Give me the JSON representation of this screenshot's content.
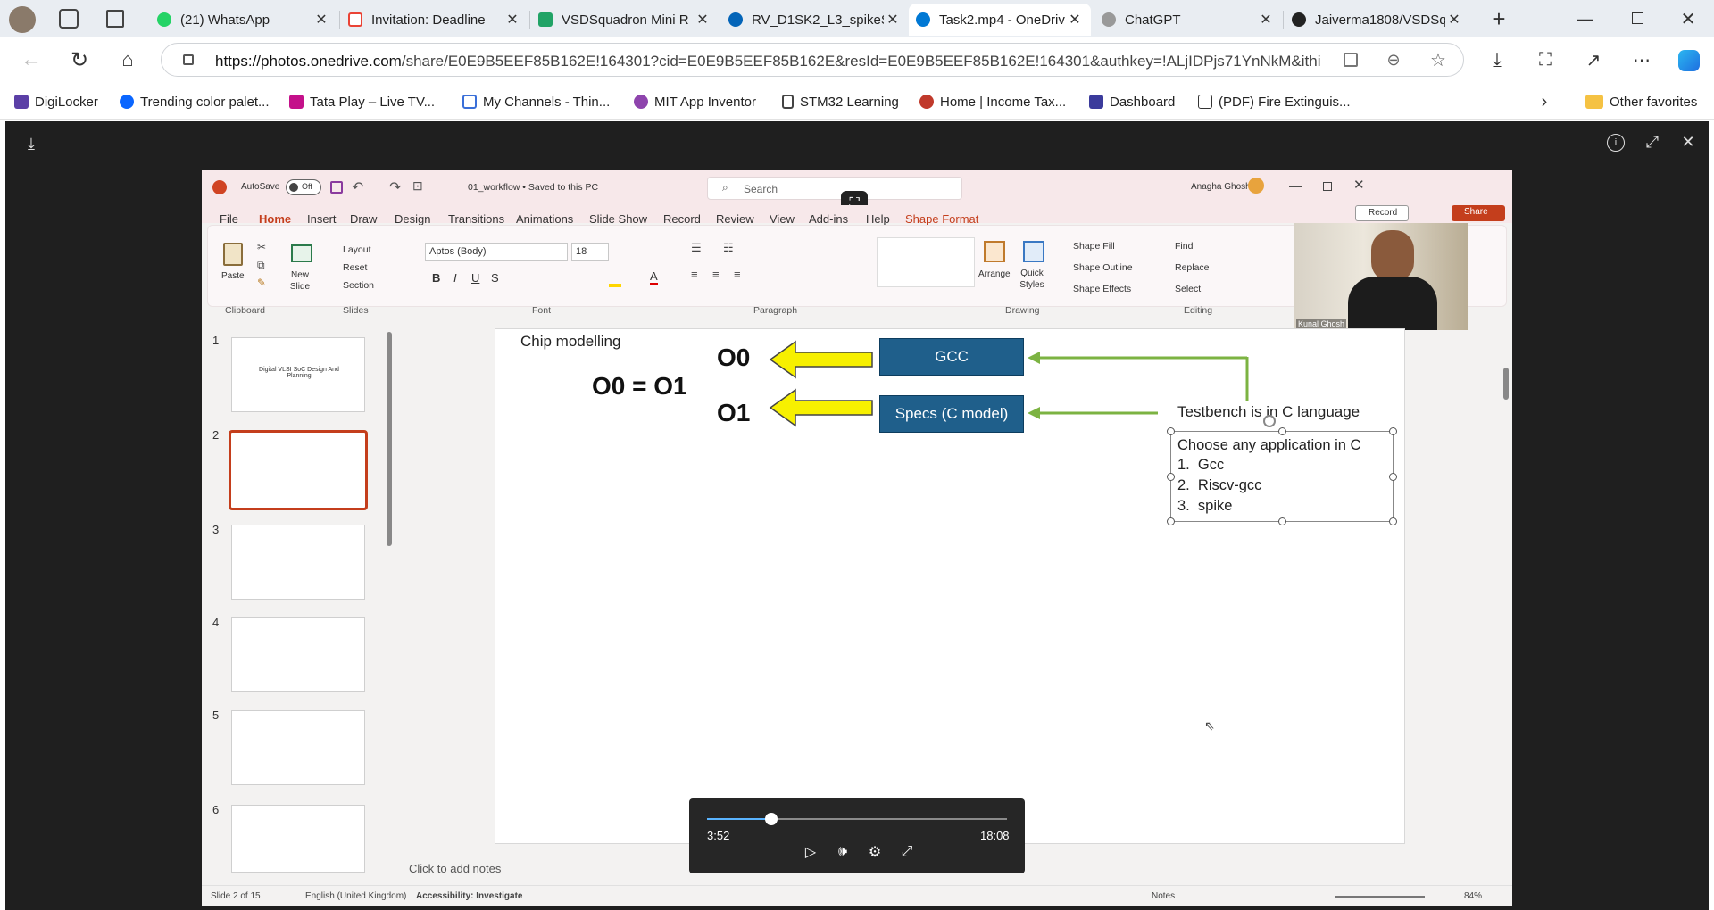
{
  "browser": {
    "tabs": [
      {
        "title": "(21) WhatsApp",
        "color": "#25d366"
      },
      {
        "title": "Invitation: Deadline",
        "color": "#ea4335"
      },
      {
        "title": "VSDSquadron Mini R",
        "color": "#21a366"
      },
      {
        "title": "RV_D1SK2_L3_spikeS",
        "color": "#0364b8"
      },
      {
        "title": "Task2.mp4 - OneDriv",
        "color": "#0078d4"
      },
      {
        "title": "ChatGPT",
        "color": "#8a8a8a"
      },
      {
        "title": "Jaiverma1808/VSDSq",
        "color": "#222222"
      }
    ],
    "url_host": "https://photos.onedrive.com",
    "url_rest": "/share/E0E9B5EEF85B162E!164301?cid=E0E9B5EEF85B162E&resId=E0E9B5EEF85B162E!164301&authkey=!ALjIDPjs71YnNkM&ithi...",
    "favorites": [
      "DigiLocker",
      "Trending color palet...",
      "Tata Play – Live TV...",
      "My Channels - Thin...",
      "MIT App Inventor",
      "STM32 Learning",
      "Home | Income Tax...",
      "Dashboard",
      "(PDF) Fire Extinguis..."
    ],
    "other_favorites": "Other favorites"
  },
  "ppt": {
    "autosave": "AutoSave",
    "autosave_state": "Off",
    "doc_title": "01_workflow • Saved to this PC",
    "search_placeholder": "Search",
    "user": "Anagha Ghosh",
    "menu": [
      "File",
      "Home",
      "Insert",
      "Draw",
      "Design",
      "Transitions",
      "Animations",
      "Slide Show",
      "Record",
      "Review",
      "View",
      "Add-ins",
      "Help",
      "Shape Format"
    ],
    "groups": {
      "clipboard": "Clipboard",
      "slides": "Slides",
      "font": "Font",
      "paragraph": "Paragraph",
      "drawing": "Drawing",
      "editing": "Editing"
    },
    "paste": "Paste",
    "new_slide": "New Slide",
    "layout": "Layout",
    "reset": "Reset",
    "section": "Section",
    "font_name": "Aptos (Body)",
    "font_size": "18",
    "arrange": "Arrange",
    "quick_styles": "Quick Styles",
    "shape_fill": "Shape Fill",
    "shape_outline": "Shape Outline",
    "shape_effects": "Shape Effects",
    "find": "Find",
    "replace": "Replace",
    "select": "Select",
    "webcam_name": "Kunal Ghosh",
    "record_btn": "Record",
    "share_btn": "Share",
    "thumb_numbers": [
      "1",
      "2",
      "3",
      "4",
      "5",
      "6"
    ],
    "thumb1_text": "Digital VLSI SoC Design And Planning",
    "slide": {
      "title": "Chip modelling",
      "equation": "O0 = O1",
      "o0": "O0",
      "o1": "O1",
      "gcc": "GCC",
      "specs": "Specs (C model)",
      "testbench": "Testbench is in C language",
      "app_heading": "Choose any application in C",
      "apps": [
        "1.  Gcc",
        "2.  Riscv-gcc",
        "3.  spike"
      ]
    },
    "notes_placeholder": "Click to add notes",
    "status": {
      "slide": "Slide 2 of 15",
      "language": "English (United Kingdom)",
      "accessibility": "Accessibility: Investigate",
      "notes": "Notes",
      "zoom": "84%"
    }
  },
  "player": {
    "current": "3:52",
    "total": "18:08",
    "progress": 0.213
  }
}
